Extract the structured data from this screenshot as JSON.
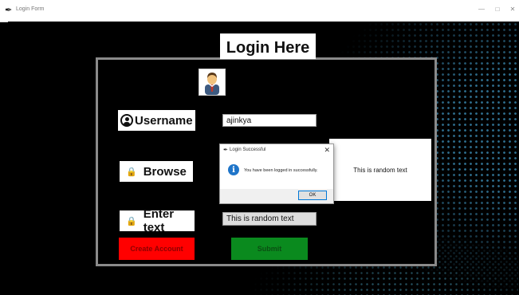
{
  "window": {
    "title": "Login Form",
    "minimize": "—",
    "maximize": "□",
    "close": "✕"
  },
  "heading": "Login Here",
  "form": {
    "username_label": "Username",
    "username_value": "ajinkya",
    "browse_label": "Browse",
    "enter_text_label": "Enter text",
    "enter_text_value": "This is random text",
    "text_panel": "This is random text",
    "create_account_button": "Create Account",
    "submit_button": "Submit"
  },
  "dialog": {
    "title": "Login Successful",
    "close": "✕",
    "message": "You have been logged in successfully.",
    "ok_button": "OK",
    "info_symbol": "i"
  },
  "icons": {
    "app": "feather-icon",
    "avatar": "businessman-avatar-icon",
    "user": "user-circle-icon",
    "lock": "lock-icon",
    "info": "info-icon"
  },
  "colors": {
    "create_button": "#ff0000",
    "submit_button": "#0a8a1e",
    "info_icon": "#1f75c9"
  }
}
